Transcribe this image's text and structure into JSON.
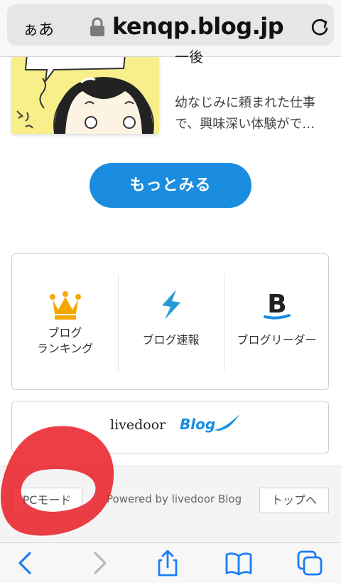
{
  "browser": {
    "text_size_button": "ぁあ",
    "domain": "kenqp.blog.jp",
    "icons": {
      "lock": "lock-icon",
      "reload": "reload-icon"
    }
  },
  "article": {
    "title": "一後",
    "excerpt": "幼なじみに頼まれた仕事で、興味深い体験がで…"
  },
  "more_button": {
    "label": "もっとみる"
  },
  "services": [
    {
      "label_line1": "ブログ",
      "label_line2": "ランキング",
      "icon": "crown-icon"
    },
    {
      "label_line1": "ブログ速報",
      "label_line2": "",
      "icon": "lightning-icon"
    },
    {
      "label_line1": "ブログリーダー",
      "label_line2": "",
      "icon": "blog-reader-b-icon"
    }
  ],
  "livedoor_banner": {
    "brand": "livedoor",
    "product": "Blog"
  },
  "footer": {
    "pc_mode": "PCモード",
    "powered_by": "Powered by livedoor Blog",
    "to_top": "トップへ"
  },
  "colors": {
    "accent_blue": "#1a8de0",
    "crown_gold": "#f5a800",
    "scribble_red": "#e8141c"
  }
}
